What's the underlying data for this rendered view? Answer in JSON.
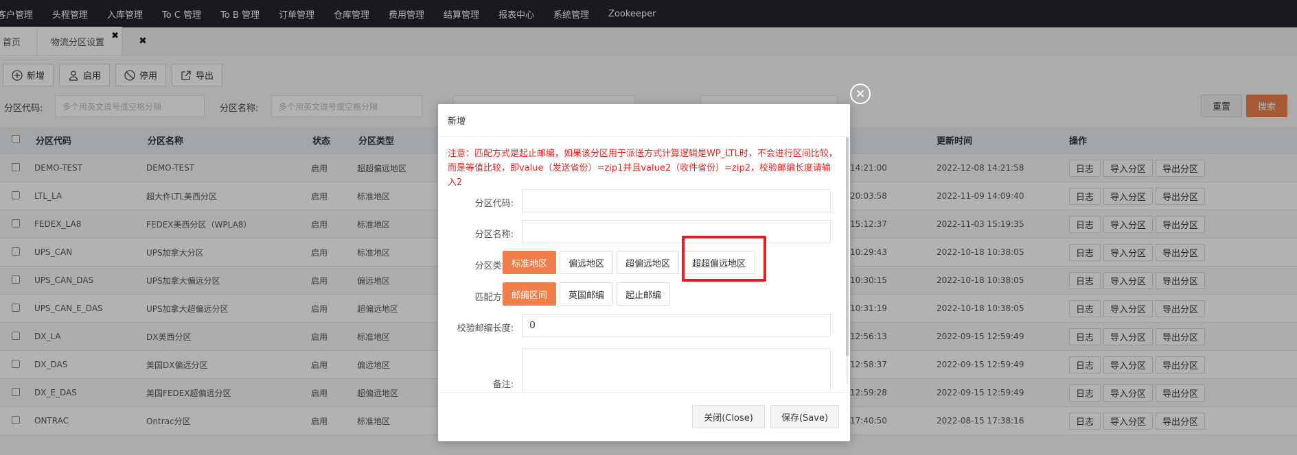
{
  "nav": [
    "客户管理",
    "头程管理",
    "入库管理",
    "To C 管理",
    "To B 管理",
    "订单管理",
    "仓库管理",
    "费用管理",
    "结算管理",
    "报表中心",
    "系统管理",
    "Zookeeper"
  ],
  "tabs": {
    "home": "首页",
    "active": "物流分区设置",
    "close_glyph": "✖",
    "closeall_glyph": "✖"
  },
  "toolbar": {
    "add": "新增",
    "enable": "启用",
    "disable": "停用",
    "export": "导出"
  },
  "filters": {
    "code_label": "分区代码:",
    "code_placeholder": "多个用英文逗号或空格分隔",
    "name_label": "分区名称:",
    "name_placeholder": "多个用英文逗号或空格分隔",
    "reset": "重置",
    "search": "搜索"
  },
  "table": {
    "headers": {
      "code": "分区代码",
      "name": "分区名称",
      "status": "状态",
      "type": "分区类型",
      "update": "更新时间",
      "ops": "操作"
    },
    "ops": {
      "log": "日志",
      "import": "导入分区",
      "export": "导出分区"
    },
    "rows": [
      {
        "code": "DEMO-TEST",
        "name": "DEMO-TEST",
        "status": "启用",
        "type": "超超偏远地区",
        "created": "14:21:00",
        "updated": "2022-12-08 14:21:58"
      },
      {
        "code": "LTL_LA",
        "name": "超大件LTL美西分区",
        "status": "启用",
        "type": "标准地区",
        "created": "20:03:58",
        "updated": "2022-11-09 14:09:40"
      },
      {
        "code": "FEDEX_LA8",
        "name": "FEDEX美西分区（WPLA8）",
        "status": "启用",
        "type": "标准地区",
        "created": "15:12:37",
        "updated": "2022-11-03 15:19:35"
      },
      {
        "code": "UPS_CAN",
        "name": "UPS加拿大分区",
        "status": "启用",
        "type": "标准地区",
        "created": "10:29:43",
        "updated": "2022-10-18 10:38:05"
      },
      {
        "code": "UPS_CAN_DAS",
        "name": "UPS加拿大偏远分区",
        "status": "启用",
        "type": "偏远地区",
        "created": "10:30:15",
        "updated": "2022-10-18 10:38:05"
      },
      {
        "code": "UPS_CAN_E_DAS",
        "name": "UPS加拿大超偏远分区",
        "status": "启用",
        "type": "超偏远地区",
        "created": "10:31:19",
        "updated": "2022-10-18 10:38:05"
      },
      {
        "code": "DX_LA",
        "name": "DX美西分区",
        "status": "启用",
        "type": "标准地区",
        "created": "12:56:13",
        "updated": "2022-09-15 12:59:49"
      },
      {
        "code": "DX_DAS",
        "name": "美国DX偏远分区",
        "status": "启用",
        "type": "偏远地区",
        "created": "12:58:37",
        "updated": "2022-09-15 12:59:49"
      },
      {
        "code": "DX_E_DAS",
        "name": "美国FEDEX超偏远分区",
        "status": "启用",
        "type": "超偏远地区",
        "created": "12:59:28",
        "updated": "2022-09-15 12:59:49"
      },
      {
        "code": "ONTRAC",
        "name": "Ontrac分区",
        "status": "启用",
        "type": "标准地区",
        "created": "17:40:50",
        "updated": "2022-08-15 17:38:16"
      }
    ]
  },
  "modal": {
    "title": "新增",
    "close_glyph": "✕",
    "notice": "注意：匹配方式是起止邮编，如果该分区用于派送方式计算逻辑是WP_LTL时，不会进行区间比较，而是等值比较，即value（发送省份）=zip1并且value2（收件省份）=zip2，校验邮编长度请输入2",
    "code_label": "分区代码:",
    "name_label": "分区名称:",
    "type_label": "分区类型:",
    "type_options": [
      "标准地区",
      "偏远地区",
      "超偏远地区",
      "超超偏远地区"
    ],
    "type_selected": "标准地区",
    "match_label": "匹配方式:",
    "match_options": [
      "邮编区间",
      "英国邮编",
      "起止邮编"
    ],
    "match_selected": "邮编区间",
    "zip_len_label": "校验邮编长度:",
    "zip_len_value": "0",
    "remark_label": "备注:",
    "close_btn": "关闭(Close)",
    "save_btn": "保存(Save)"
  },
  "colors": {
    "accent": "#f07f4b",
    "highlight": "#e51c23",
    "topnav": "#23262e",
    "notice": "#e22222"
  }
}
